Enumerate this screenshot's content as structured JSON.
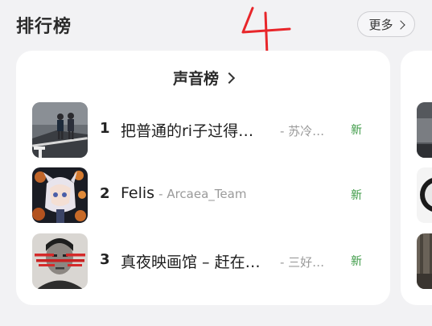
{
  "section": {
    "title": "排行榜",
    "more_label": "更多",
    "annotation_text": "4"
  },
  "card": {
    "title": "声音榜",
    "items": [
      {
        "rank": "1",
        "title": "把普通的ri子过得…",
        "artist": "- 苏冷…",
        "badge": "新",
        "cover_icon": "two-children-walking-photo"
      },
      {
        "rank": "2",
        "title": "Felis",
        "artist": "- Arcaea_Team",
        "badge": "新",
        "cover_icon": "anime-girl-artwork"
      },
      {
        "rank": "3",
        "title": "真夜映画馆 – 赶在…",
        "artist": "- 三好…",
        "badge": "新",
        "cover_icon": "portrait-with-red-text"
      }
    ]
  },
  "colors": {
    "background": "#f2f2f4",
    "card": "#ffffff",
    "new_badge": "#3c9a45",
    "annotation": "#e8262a",
    "artist_text": "#9a9a9a"
  }
}
